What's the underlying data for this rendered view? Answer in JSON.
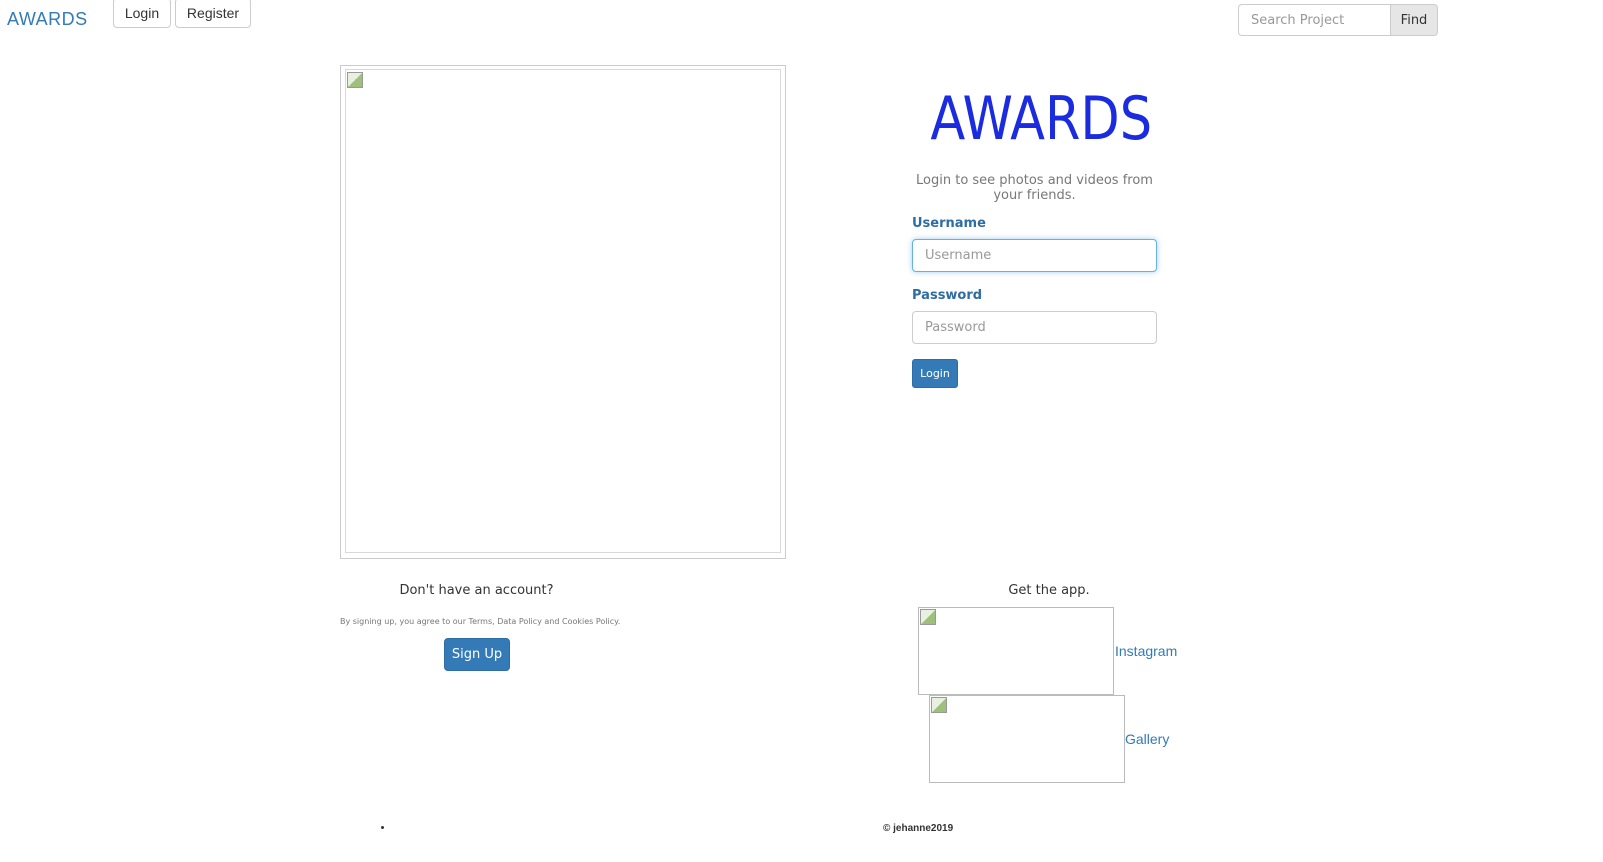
{
  "navbar": {
    "brand": "AWARDS",
    "login_label": "Login",
    "register_label": "Register",
    "search_placeholder": "Search Project",
    "find_label": "Find"
  },
  "login": {
    "title": "AWARDS",
    "subtitle": "Login to see photos and videos from your friends.",
    "username_label": "Username",
    "username_placeholder": "Username",
    "password_label": "Password",
    "password_placeholder": "Password",
    "submit_label": "Login"
  },
  "signup": {
    "prompt": "Don't have an account?",
    "terms": "By signing up, you agree to our Terms, Data Policy and Cookies Policy.",
    "button_label": "Sign Up"
  },
  "get_app": {
    "heading": "Get the app.",
    "links": [
      {
        "label": "Instagram"
      },
      {
        "label": "Gallery"
      }
    ]
  },
  "footer": {
    "copyright": "© jehanne2019"
  },
  "colors": {
    "brand": "#337ab7",
    "title": "#1a2be0",
    "primary_button": "#337ab7"
  }
}
